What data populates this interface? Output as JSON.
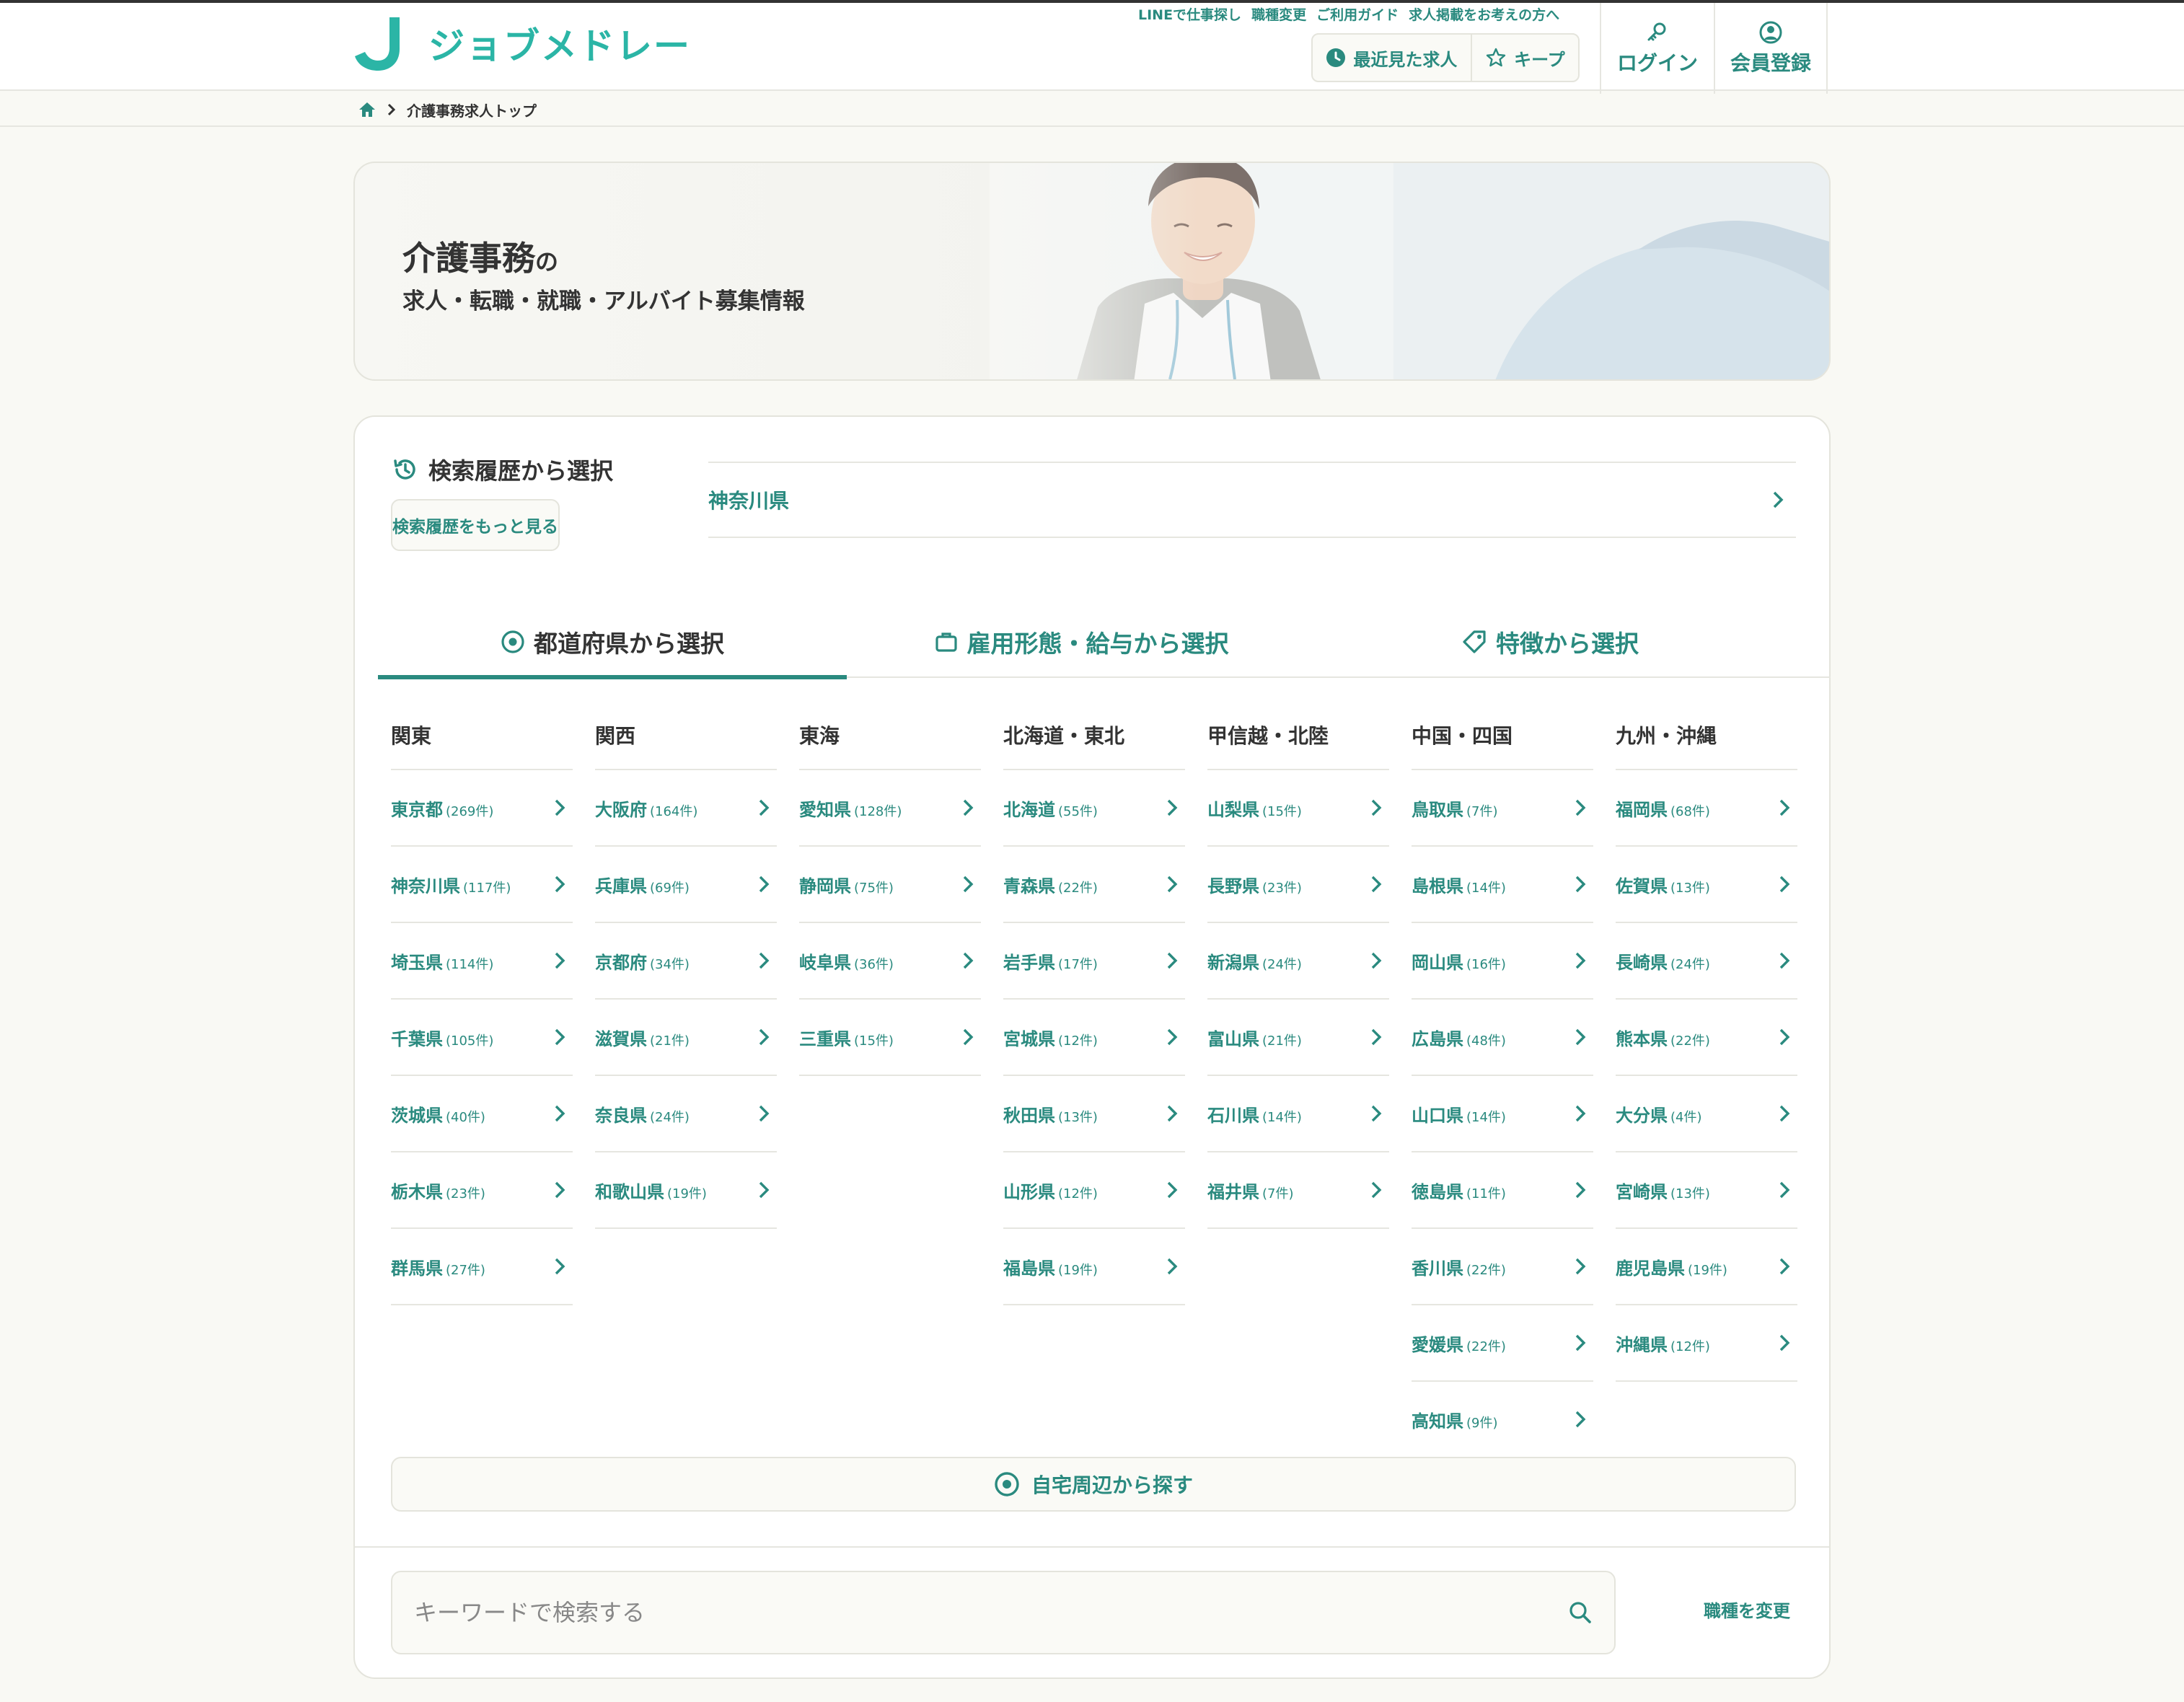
{
  "brand": {
    "logo_text": "ジョブメドレー"
  },
  "header": {
    "top_links": [
      "LINEで仕事探し",
      "職種変更",
      "ご利用ガイド",
      "求人掲載をお考えの方へ"
    ],
    "recent_label": "最近見た求人",
    "keep_label": "キープ",
    "login_label": "ログイン",
    "register_label": "会員登録"
  },
  "breadcrumb": {
    "current": "介護事務求人トップ"
  },
  "hero": {
    "title": "介護事務",
    "title_suffix": "の",
    "subtitle": "求人・転職・就職・アルバイト募集情報"
  },
  "history": {
    "title": "検索履歴から選択",
    "more_label": "検索履歴をもっと見る",
    "items": [
      "神奈川県"
    ]
  },
  "tabs": [
    {
      "label": "都道府県から選択",
      "active": true,
      "icon": "location-pin-icon"
    },
    {
      "label": "雇用形態・給与から選択",
      "active": false,
      "icon": "briefcase-icon"
    },
    {
      "label": "特徴から選択",
      "active": false,
      "icon": "tag-icon"
    }
  ],
  "regions": [
    {
      "name": "関東",
      "prefs": [
        {
          "name": "東京都",
          "count": "(269件)"
        },
        {
          "name": "神奈川県",
          "count": "(117件)"
        },
        {
          "name": "埼玉県",
          "count": "(114件)"
        },
        {
          "name": "千葉県",
          "count": "(105件)"
        },
        {
          "name": "茨城県",
          "count": "(40件)"
        },
        {
          "name": "栃木県",
          "count": "(23件)"
        },
        {
          "name": "群馬県",
          "count": "(27件)"
        }
      ]
    },
    {
      "name": "関西",
      "prefs": [
        {
          "name": "大阪府",
          "count": "(164件)"
        },
        {
          "name": "兵庫県",
          "count": "(69件)"
        },
        {
          "name": "京都府",
          "count": "(34件)"
        },
        {
          "name": "滋賀県",
          "count": "(21件)"
        },
        {
          "name": "奈良県",
          "count": "(24件)"
        },
        {
          "name": "和歌山県",
          "count": "(19件)"
        }
      ]
    },
    {
      "name": "東海",
      "prefs": [
        {
          "name": "愛知県",
          "count": "(128件)"
        },
        {
          "name": "静岡県",
          "count": "(75件)"
        },
        {
          "name": "岐阜県",
          "count": "(36件)"
        },
        {
          "name": "三重県",
          "count": "(15件)"
        }
      ]
    },
    {
      "name": "北海道・東北",
      "prefs": [
        {
          "name": "北海道",
          "count": "(55件)"
        },
        {
          "name": "青森県",
          "count": "(22件)"
        },
        {
          "name": "岩手県",
          "count": "(17件)"
        },
        {
          "name": "宮城県",
          "count": "(12件)"
        },
        {
          "name": "秋田県",
          "count": "(13件)"
        },
        {
          "name": "山形県",
          "count": "(12件)"
        },
        {
          "name": "福島県",
          "count": "(19件)"
        }
      ]
    },
    {
      "name": "甲信越・北陸",
      "prefs": [
        {
          "name": "山梨県",
          "count": "(15件)"
        },
        {
          "name": "長野県",
          "count": "(23件)"
        },
        {
          "name": "新潟県",
          "count": "(24件)"
        },
        {
          "name": "富山県",
          "count": "(21件)"
        },
        {
          "name": "石川県",
          "count": "(14件)"
        },
        {
          "name": "福井県",
          "count": "(7件)"
        }
      ]
    },
    {
      "name": "中国・四国",
      "prefs": [
        {
          "name": "鳥取県",
          "count": "(7件)"
        },
        {
          "name": "島根県",
          "count": "(14件)"
        },
        {
          "name": "岡山県",
          "count": "(16件)"
        },
        {
          "name": "広島県",
          "count": "(48件)"
        },
        {
          "name": "山口県",
          "count": "(14件)"
        },
        {
          "name": "徳島県",
          "count": "(11件)"
        },
        {
          "name": "香川県",
          "count": "(22件)"
        },
        {
          "name": "愛媛県",
          "count": "(22件)"
        },
        {
          "name": "高知県",
          "count": "(9件)"
        }
      ]
    },
    {
      "name": "九州・沖縄",
      "prefs": [
        {
          "name": "福岡県",
          "count": "(68件)"
        },
        {
          "name": "佐賀県",
          "count": "(13件)"
        },
        {
          "name": "長崎県",
          "count": "(24件)"
        },
        {
          "name": "熊本県",
          "count": "(22件)"
        },
        {
          "name": "大分県",
          "count": "(4件)"
        },
        {
          "name": "宮崎県",
          "count": "(13件)"
        },
        {
          "name": "鹿児島県",
          "count": "(19件)"
        },
        {
          "name": "沖縄県",
          "count": "(12件)"
        }
      ]
    }
  ],
  "near_search": {
    "label": "自宅周辺から探す"
  },
  "search": {
    "placeholder": "キーワードで検索する",
    "value": ""
  },
  "change_job_label": "職種を変更",
  "colors": {
    "accent": "#2a8a7f",
    "brand": "#2bb5a6",
    "background": "#f9f9f4"
  }
}
